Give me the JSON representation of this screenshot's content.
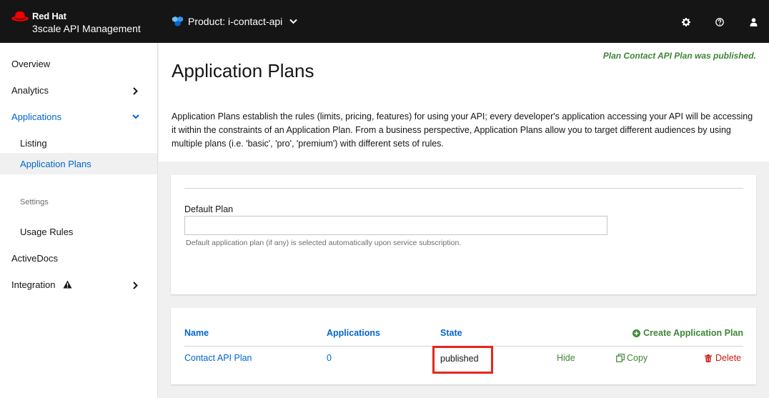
{
  "header": {
    "brand_name": "Red Hat",
    "brand_sub": "3scale API Management",
    "product_label": "Product: i-contact-api",
    "icons": [
      "gear-icon",
      "help-icon",
      "user-icon"
    ]
  },
  "sidebar": {
    "items": [
      {
        "label": "Overview"
      },
      {
        "label": "Analytics"
      },
      {
        "label": "Applications"
      },
      {
        "label": "Listing"
      },
      {
        "label": "Application Plans"
      },
      {
        "label": "Usage Rules"
      },
      {
        "label": "ActiveDocs"
      },
      {
        "label": "Integration"
      }
    ],
    "settings_label": "Settings"
  },
  "main": {
    "flash": "Plan Contact API Plan was published.",
    "title": "Application Plans",
    "description": "Application Plans establish the rules (limits, pricing, features) for using your API; every developer's application accessing your API will be accessing it within the constraints of an Application Plan. From a business perspective, Application Plans allow you to target different audiences by using multiple plans (i.e. 'basic', 'pro', 'premium') with different sets of rules.",
    "default_plan": {
      "label": "Default Plan",
      "value": "",
      "help": "Default application plan (if any) is selected automatically upon service subscription."
    },
    "table": {
      "headers": [
        "Name",
        "Applications",
        "State"
      ],
      "create_label": "Create Application Plan",
      "rows": [
        {
          "name": "Contact API Plan",
          "applications": "0",
          "state": "published",
          "hide": "Hide",
          "copy": "Copy",
          "delete": "Delete"
        }
      ]
    }
  },
  "colors": {
    "topbar": "#151515",
    "link": "#0066cc",
    "success": "#3e8635",
    "danger": "#c9190b",
    "highlight": "#e5261f",
    "brand_red": "#ee0000"
  }
}
